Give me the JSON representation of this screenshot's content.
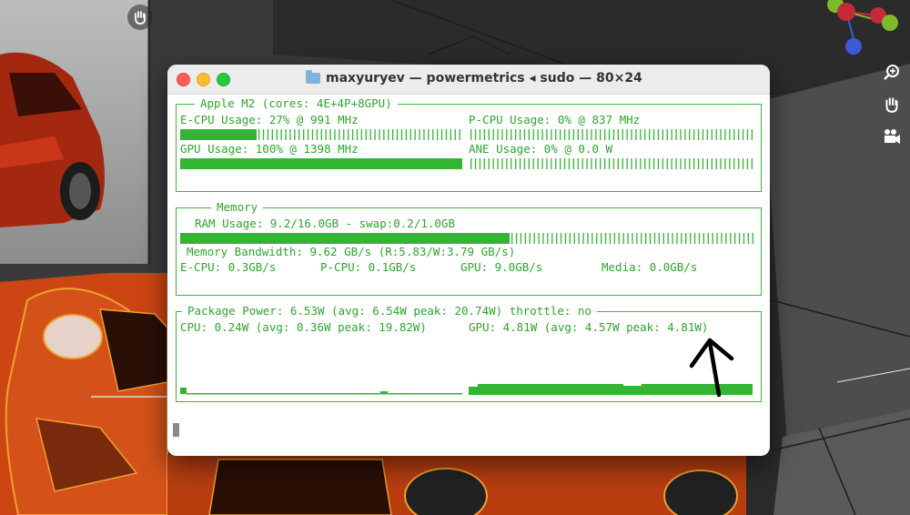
{
  "window": {
    "title": "maxyuryev — powermetrics ◂ sudo — 80×24",
    "icon": "folder-icon"
  },
  "chip": {
    "title": "Apple M2 (cores: 4E+4P+8GPU)",
    "ecpu_label": "E-CPU Usage: 27% @ 991 MHz",
    "ecpu_usage": 0.27,
    "pcpu_label": "P-CPU Usage: 0% @ 837 MHz",
    "pcpu_usage": 0.0,
    "gpu_label": "GPU Usage: 100% @ 1398 MHz",
    "gpu_usage": 1.0,
    "ane_label": "ANE Usage: 0% @ 0.0 W",
    "ane_usage": 0.0
  },
  "memory": {
    "title": "Memory",
    "ram_label": "RAM Usage: 9.2/16.0GB - swap:0.2/1.0GB",
    "ram_usage": 0.575,
    "bandwidth_label": "Memory Bandwidth: 9.62 GB/s (R:5.83/W:3.79 GB/s)",
    "ecpu_bw": "E-CPU: 0.3GB/s",
    "pcpu_bw": "P-CPU: 0.1GB/s",
    "gpu_bw": "GPU: 9.0GB/s",
    "media_bw": "Media: 0.0GB/s"
  },
  "power": {
    "title": "Package Power: 6.53W (avg: 6.54W peak: 20.74W) throttle: no",
    "cpu_label": "CPU: 0.24W (avg: 0.36W peak: 19.82W)",
    "gpu_label": "GPU: 4.81W (avg: 4.57W peak: 4.81W)"
  },
  "colors": {
    "terminal_green": "#2ea52e",
    "bar_green": "#33b533",
    "annotation": "#000000"
  },
  "toolbar_icons": [
    "zoom-icon",
    "hand-icon",
    "camera-icon"
  ]
}
